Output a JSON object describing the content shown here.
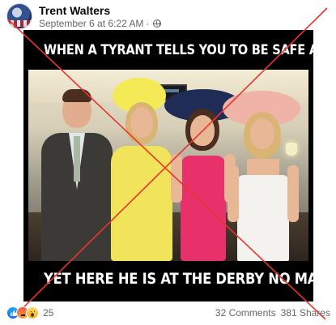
{
  "post": {
    "author": "Trent Walters",
    "timestamp": "September 6 at 6:22 AM",
    "separator": "·",
    "privacy_icon": "globe-icon"
  },
  "image": {
    "caption_top": "WHEN A TYRANT TELLS YOU TO BE SAFE AT HOME",
    "caption_bottom": "YET HERE HE IS AT THE DERBY NO MASK",
    "overlay": "red-x"
  },
  "footer": {
    "reaction_icons": [
      "like-icon",
      "angry-icon",
      "wow-icon"
    ],
    "reaction_count": "25",
    "comments": "32 Comments",
    "shares": "381 Shares"
  },
  "colors": {
    "overlay_red": "#e8342f",
    "meta_gray": "#65676b",
    "like_blue": "#0866ff"
  }
}
